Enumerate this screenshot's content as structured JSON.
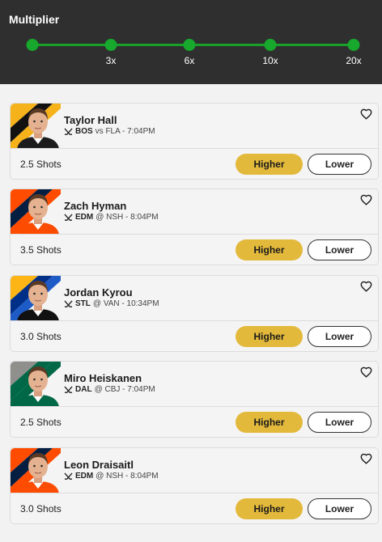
{
  "header": {
    "title": "Multiplier",
    "levels": [
      "",
      "3x",
      "6x",
      "10x",
      "20x"
    ]
  },
  "colors": {
    "header_bg": "#2f2f2f",
    "slider_green": "#17a82d",
    "higher_button": "#e3b93b"
  },
  "buttons": {
    "higher": "Higher",
    "lower": "Lower"
  },
  "players": [
    {
      "name": "Taylor Hall",
      "team": "BOS",
      "matchup": "vs FLA - 7:04PM",
      "line": "2.5 Shots",
      "icon": "hockey-sticks-icon",
      "stripe_colors": [
        "#f5b21b",
        "#111111",
        "#f5b21b"
      ],
      "jersey": "#1c1c1c"
    },
    {
      "name": "Zach Hyman",
      "team": "EDM",
      "matchup": "@ NSH - 8:04PM",
      "line": "3.5 Shots",
      "icon": "hockey-sticks-icon",
      "stripe_colors": [
        "#ff4c00",
        "#041e42",
        "#ff4c00"
      ],
      "jersey": "#fc4c02"
    },
    {
      "name": "Jordan Kyrou",
      "team": "STL",
      "matchup": "@ VAN - 10:34PM",
      "line": "3.0 Shots",
      "icon": "hockey-sticks-icon",
      "stripe_colors": [
        "#fcb514",
        "#002f87",
        "#1e5bc6"
      ],
      "jersey": "#111111"
    },
    {
      "name": "Miro Heiskanen",
      "team": "DAL",
      "matchup": "@ CBJ - 7:04PM",
      "line": "2.5 Shots",
      "icon": "hockey-sticks-icon",
      "stripe_colors": [
        "#8f8f8c",
        "#006847",
        "#006847"
      ],
      "jersey": "#006847"
    },
    {
      "name": "Leon Draisaitl",
      "team": "EDM",
      "matchup": "@ NSH - 8:04PM",
      "line": "3.0 Shots",
      "icon": "hockey-sticks-icon",
      "stripe_colors": [
        "#ff4c00",
        "#041e42",
        "#ff4c00"
      ],
      "jersey": "#fc4c02"
    }
  ]
}
